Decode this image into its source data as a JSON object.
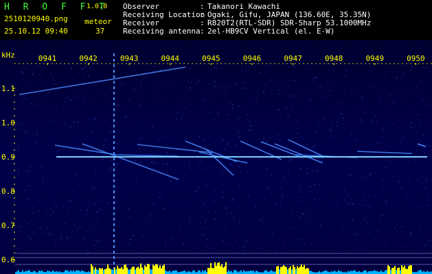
{
  "app": {
    "logo": "H R O F F T",
    "version": "1.0.0"
  },
  "file": {
    "name": "2510120940.png",
    "timestamp": "25.10.12 09:40"
  },
  "meteor": {
    "label": "meteor",
    "count": "37"
  },
  "station": {
    "rows": [
      {
        "label": "Observer",
        "sep": ":",
        "value": "Takanori Kawachi"
      },
      {
        "label": "Receiving Location",
        "sep": ":",
        "value": "Ogaki, Gifu, JAPAN (136.60E, 35.35N)"
      },
      {
        "label": "Receiver",
        "sep": ":",
        "value": "R820T2(RTL-SDR) SDR-Sharp 53.1000MHz"
      },
      {
        "label": "Receiving antenna",
        "sep": ":",
        "value": "2el-HB9CV Vertical (el. E-W)"
      }
    ]
  },
  "chart_data": {
    "type": "heatmap",
    "ylabel": "kHz",
    "ylim": [
      0.6,
      1.2
    ],
    "x_ticks": [
      "0941",
      "0942",
      "0943",
      "0944",
      "0945",
      "0946",
      "0947",
      "0948",
      "0949",
      "0950"
    ],
    "y_ticks": [
      "1.1",
      "1.0",
      "0.9",
      "0.8",
      "0.7",
      "0.6"
    ],
    "y_tick_values": [
      1.1,
      1.0,
      0.9,
      0.8,
      0.7,
      0.6
    ],
    "carrier_khz": 0.9,
    "colors": {
      "background": "#00003c",
      "axis_text": "#ffff00",
      "signal": "#50a0ff",
      "activity": "#ffff00",
      "noise": "#00b4ff"
    }
  }
}
